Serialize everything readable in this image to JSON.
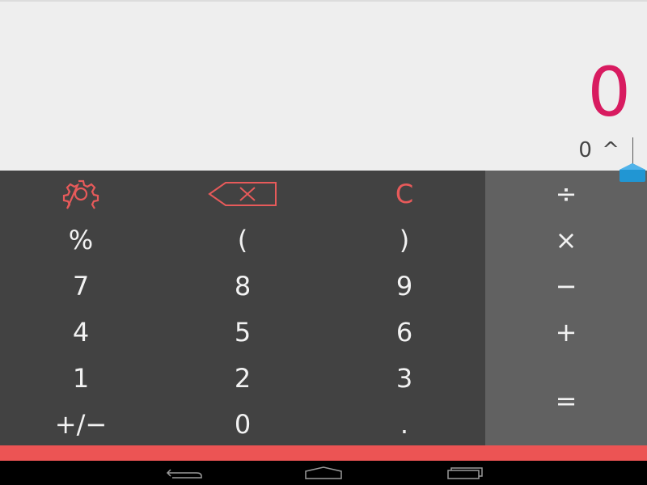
{
  "display": {
    "result": "0",
    "expression": "0 ^"
  },
  "keypad": {
    "row1": {
      "settings_icon": "gear-icon",
      "backspace_icon": "backspace-icon",
      "clear": "C"
    },
    "row2": [
      "%",
      "(",
      ")"
    ],
    "row3": [
      "7",
      "8",
      "9"
    ],
    "row4": [
      "4",
      "5",
      "6"
    ],
    "row5": [
      "1",
      "2",
      "3"
    ],
    "row6": [
      "+/−",
      "0",
      "."
    ]
  },
  "operators": {
    "divide": "÷",
    "multiply": "×",
    "minus": "−",
    "plus": "+",
    "equals": "="
  },
  "navbar": {
    "back_icon": "back-icon",
    "home_icon": "home-icon",
    "recents_icon": "recents-icon"
  },
  "colors": {
    "result": "#d81b60",
    "accent": "#ec5454",
    "keypad_bg": "#424242",
    "operators_bg": "#616161",
    "display_bg": "#eeeeee",
    "cursor_handle": "#2196d3"
  }
}
